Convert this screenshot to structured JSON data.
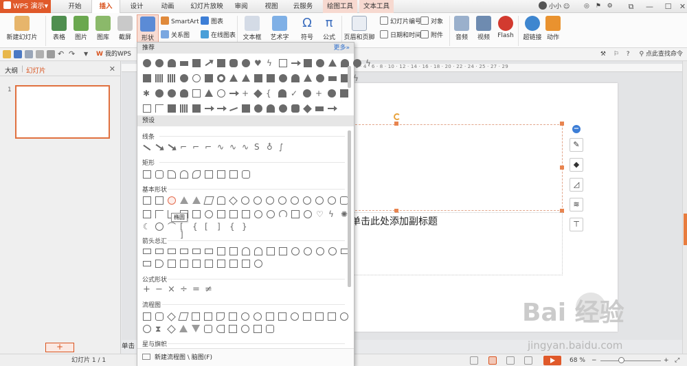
{
  "app": {
    "name": "WPS 演示"
  },
  "tabs": [
    "开始",
    "插入",
    "设计",
    "动画",
    "幻灯片放映",
    "审阅",
    "视图",
    "云服务",
    "绘图工具",
    "文本工具"
  ],
  "active_tab": "插入",
  "user": {
    "name": "小小"
  },
  "ribbon": {
    "new_slide": "新建幻灯片",
    "table": "表格",
    "picture": "图片",
    "gallery": "图库",
    "screenshot": "截屏",
    "shapes": "形状",
    "smartart": "SmartArt",
    "chart": "图表",
    "relation": "关系图",
    "online_chart": "在线图表",
    "textbox": "文本框",
    "wordart": "艺术字",
    "symbol": "符号",
    "formula": "公式",
    "header_footer": "页眉和页脚",
    "slide_number": "幻灯片编号",
    "datetime": "日期和时间",
    "object": "对象",
    "attachment": "附件",
    "audio": "音频",
    "video": "视频",
    "flash": "Flash",
    "hyperlink": "超链接",
    "action": "动作"
  },
  "qat": {
    "mywps": "我的WPS",
    "search": "点此查找命令"
  },
  "left_panel": {
    "tab_outline": "大纲",
    "tab_slides": "幻灯片",
    "slide_number": "1",
    "add_slide": "+"
  },
  "ruler_text": "1 · 4 · 6 · 8 · 10 · 12 · 14 · 16 · 18 · 20 · 22 · 24 · 25 · 27 · 29",
  "slide": {
    "subtitle": "单击此处添加副标题"
  },
  "notes_label": "单击",
  "status": {
    "slide_info": "幻灯片 1 / 1",
    "zoom": "68 %"
  },
  "shapes_menu": {
    "recommended": "推荐",
    "more": "更多»",
    "presets": "预设",
    "categories": [
      "线条",
      "矩形",
      "基本形状",
      "箭头总汇",
      "公式形状",
      "流程图",
      "星与旗帜"
    ],
    "tooltip": "椭圆",
    "new_flowchart": "新建流程图 \\ 脑图(F)"
  },
  "watermark": {
    "brand": "Bai 经验",
    "url": "jingyan.baidu.com"
  },
  "colors": {
    "accent": "#e0592a",
    "active_tab": "#d9531e",
    "tool_tab": "#f7d9d0"
  }
}
